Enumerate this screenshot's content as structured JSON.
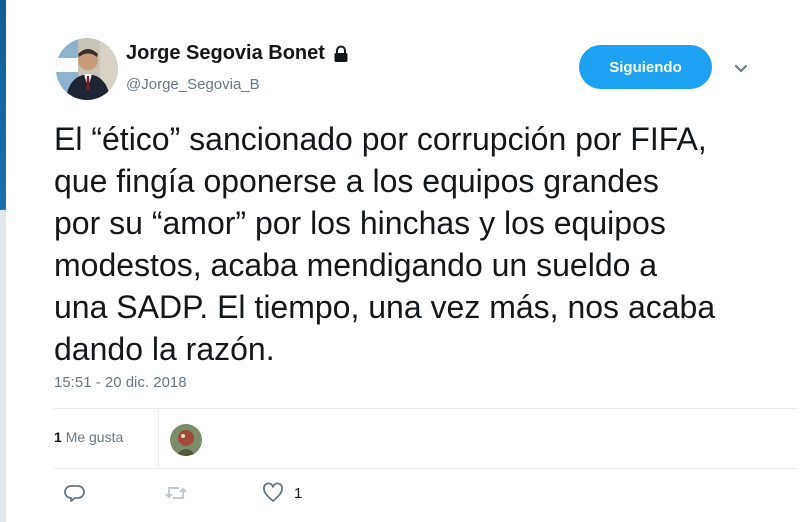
{
  "colors": {
    "accent": "#1da1f2",
    "text_primary": "#14171a",
    "text_secondary": "#657786",
    "divider": "#e6ecf0"
  },
  "tweet": {
    "author_name": "Jorge Segovia Bonet",
    "author_handle": "@Jorge_Segovia_B",
    "protected_icon": "lock-icon",
    "follow_button_label": "Siguiendo",
    "menu_icon": "chevron-down-icon",
    "text": "El “ético” sancionado por corrupción por FIFA,\nque fingía oponerse a los equipos grandes\npor su “amor” por los hinchas y los equipos\nmodestos, acaba mendigando un sueldo a\nuna  SADP. El tiempo, una vez más, nos acaba\ndando la razón.",
    "timestamp": "15:51 - 20 dic. 2018",
    "likes_number": "1",
    "likes_label": "Me gusta"
  },
  "actions": {
    "reply_icon": "reply-icon",
    "retweet_icon": "retweet-icon",
    "like_icon": "heart-icon",
    "like_count": "1"
  }
}
